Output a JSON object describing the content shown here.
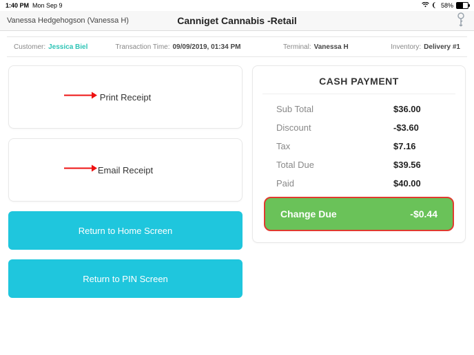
{
  "status": {
    "time": "1:40 PM",
    "date": "Mon Sep 9",
    "battery_pct": "58%"
  },
  "header": {
    "user": "Vanessa Hedgehogson (Vanessa H)",
    "store": "Canniget Cannabis -Retail"
  },
  "info": {
    "customer_label": "Customer:",
    "customer_value": "Jessica Biel",
    "txn_label": "Transaction Time:",
    "txn_value": "09/09/2019, 01:34 PM",
    "terminal_label": "Terminal:",
    "terminal_value": "Vanessa H",
    "inventory_label": "Inventory:",
    "inventory_value": "Delivery #1"
  },
  "actions": {
    "print_receipt": "Print Receipt",
    "email_receipt": "Email Receipt",
    "home": "Return to Home Screen",
    "pin": "Return to PIN Screen"
  },
  "payment": {
    "title": "CASH PAYMENT",
    "rows": {
      "subtotal_label": "Sub Total",
      "subtotal_value": "$36.00",
      "discount_label": "Discount",
      "discount_value": "-$3.60",
      "tax_label": "Tax",
      "tax_value": "$7.16",
      "total_label": "Total Due",
      "total_value": "$39.56",
      "paid_label": "Paid",
      "paid_value": "$40.00"
    },
    "change_label": "Change Due",
    "change_value": "-$0.44"
  }
}
